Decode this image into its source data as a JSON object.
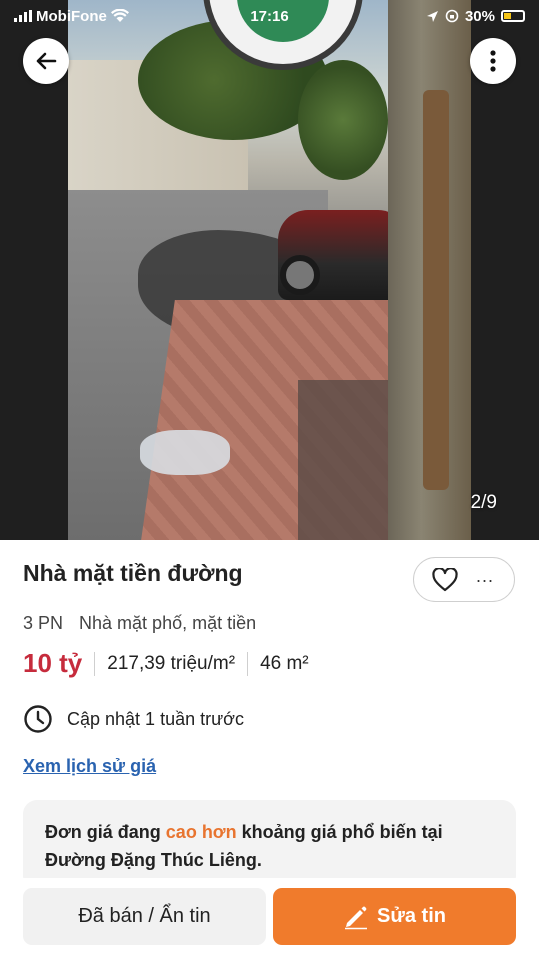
{
  "status_bar": {
    "carrier": "MobiFone",
    "time": "17:16",
    "battery": "30%"
  },
  "gallery": {
    "counter": "2/9"
  },
  "listing": {
    "title": "Nhà mặt tiền đường",
    "bedrooms": "3 PN",
    "property_type": "Nhà mặt phố, mặt tiền",
    "price": "10 tỷ",
    "unit_price": "217,39 triệu/m²",
    "area": "46 m²",
    "updated": "Cập nhật 1 tuần trước",
    "price_history_link": "Xem lịch sử giá"
  },
  "price_note": {
    "prefix": "Đơn giá đang ",
    "highlight": "cao hơn",
    "suffix": " khoảng giá phổ biến tại Đường Đặng Thúc Liêng."
  },
  "actions": {
    "more_label": "...",
    "sold_hide_label": "Đã bán / Ẩn tin",
    "edit_label": "Sửa tin"
  },
  "colors": {
    "price": "#c62b3c",
    "link": "#2a63b0",
    "highlight": "#e8742f",
    "primary_button": "#f07b2c"
  }
}
